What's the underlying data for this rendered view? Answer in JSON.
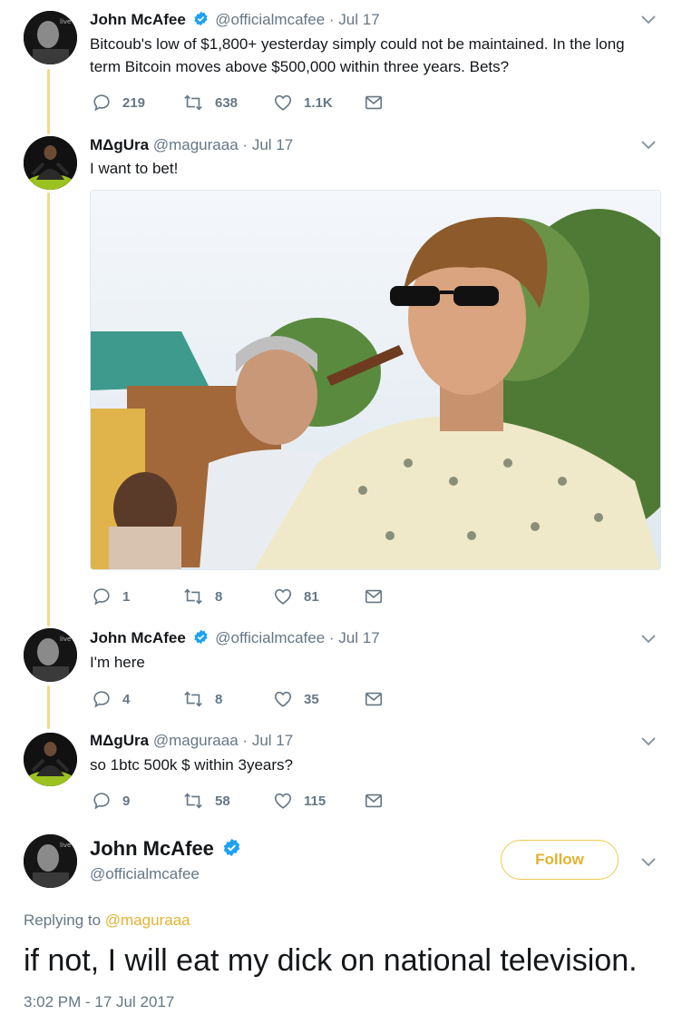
{
  "tweets": [
    {
      "name": "John McAfee",
      "verified": true,
      "handle": "@officialmcafee",
      "dot": "·",
      "date": "Jul 17",
      "text_line1": "Bitcoub's low of $1,800+ yesterday simply could not be maintained. In the long",
      "text_line2": "term Bitcoin moves above  $500,000 within three years. Bets?",
      "replies": "219",
      "retweets": "638",
      "likes": "1.1K"
    },
    {
      "name": "MΔgUra",
      "verified": false,
      "handle": "@maguraaa",
      "dot": "·",
      "date": "Jul 17",
      "text_line1": "I want to bet!",
      "replies": "1",
      "retweets": "8",
      "likes": "81"
    },
    {
      "name": "John McAfee",
      "verified": true,
      "handle": "@officialmcafee",
      "dot": "·",
      "date": "Jul 17",
      "text_line1": "I'm here",
      "replies": "4",
      "retweets": "8",
      "likes": "35"
    },
    {
      "name": "MΔgUra",
      "verified": false,
      "handle": "@maguraaa",
      "dot": "·",
      "date": "Jul 17",
      "text_line1": "so 1btc 500k $ within 3years?",
      "replies": "9",
      "retweets": "58",
      "likes": "115"
    }
  ],
  "main_tweet": {
    "name": "John McAfee",
    "handle": "@officialmcafee",
    "follow_label": "Follow",
    "replying_prefix": "Replying to",
    "replying_mention": "@maguraaa",
    "text": "if not, I will eat my dick on national television.",
    "timestamp": "3:02 PM - 17 Jul 2017"
  },
  "colors": {
    "thread_line": "#f5d98a",
    "accent": "#e2b231",
    "verified": "#1da1f2",
    "secondary_text": "#657786"
  },
  "icons": {
    "reply": "reply-icon",
    "retweet": "retweet-icon",
    "like": "heart-icon",
    "message": "envelope-icon",
    "more": "chevron-down-icon"
  }
}
